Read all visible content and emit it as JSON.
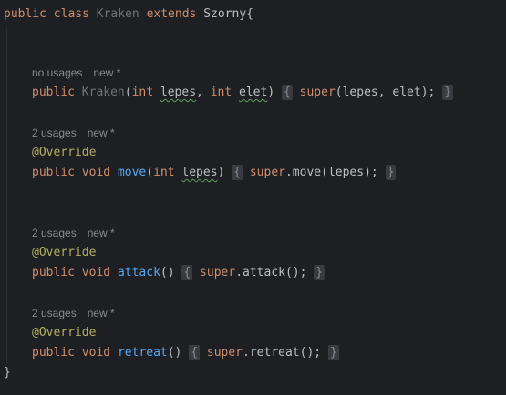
{
  "header": {
    "kw_public": "public",
    "kw_class": "class",
    "class_name": "Kraken",
    "kw_extends": "extends",
    "parent": "Szorny",
    "open_brace": "{"
  },
  "constructor": {
    "hint_usages": "no usages",
    "hint_new": "new *",
    "kw_public": "public",
    "name": "Kraken",
    "type1": "int",
    "param1": "lepes",
    "type2": "int",
    "param2": "elet",
    "body_open": "{",
    "kw_super": "super",
    "call": "(lepes, elet);",
    "body_close": "}"
  },
  "move": {
    "hint_usages": "2 usages",
    "hint_new": "new *",
    "annotation": "@Override",
    "kw_public": "public",
    "kw_void": "void",
    "name": "move",
    "type": "int",
    "param": "lepes",
    "body_open": "{",
    "kw_super": "super",
    "call": ".move(lepes);",
    "body_close": "}"
  },
  "attack": {
    "hint_usages": "2 usages",
    "hint_new": "new *",
    "annotation": "@Override",
    "kw_public": "public",
    "kw_void": "void",
    "name": "attack",
    "parens": "()",
    "body_open": "{",
    "kw_super": "super",
    "call": ".attack();",
    "body_close": "}"
  },
  "retreat": {
    "hint_usages": "2 usages",
    "hint_new": "new *",
    "annotation": "@Override",
    "kw_public": "public",
    "kw_void": "void",
    "name": "retreat",
    "parens": "()",
    "body_open": "{",
    "kw_super": "super",
    "call": ".retreat();",
    "body_close": "}"
  },
  "footer": {
    "close_brace": "}"
  },
  "colors": {
    "background": "#1e1f22",
    "keyword": "#cf8e6d",
    "function": "#56a8f5",
    "annotation": "#b3ae60",
    "text": "#bcbec4"
  }
}
